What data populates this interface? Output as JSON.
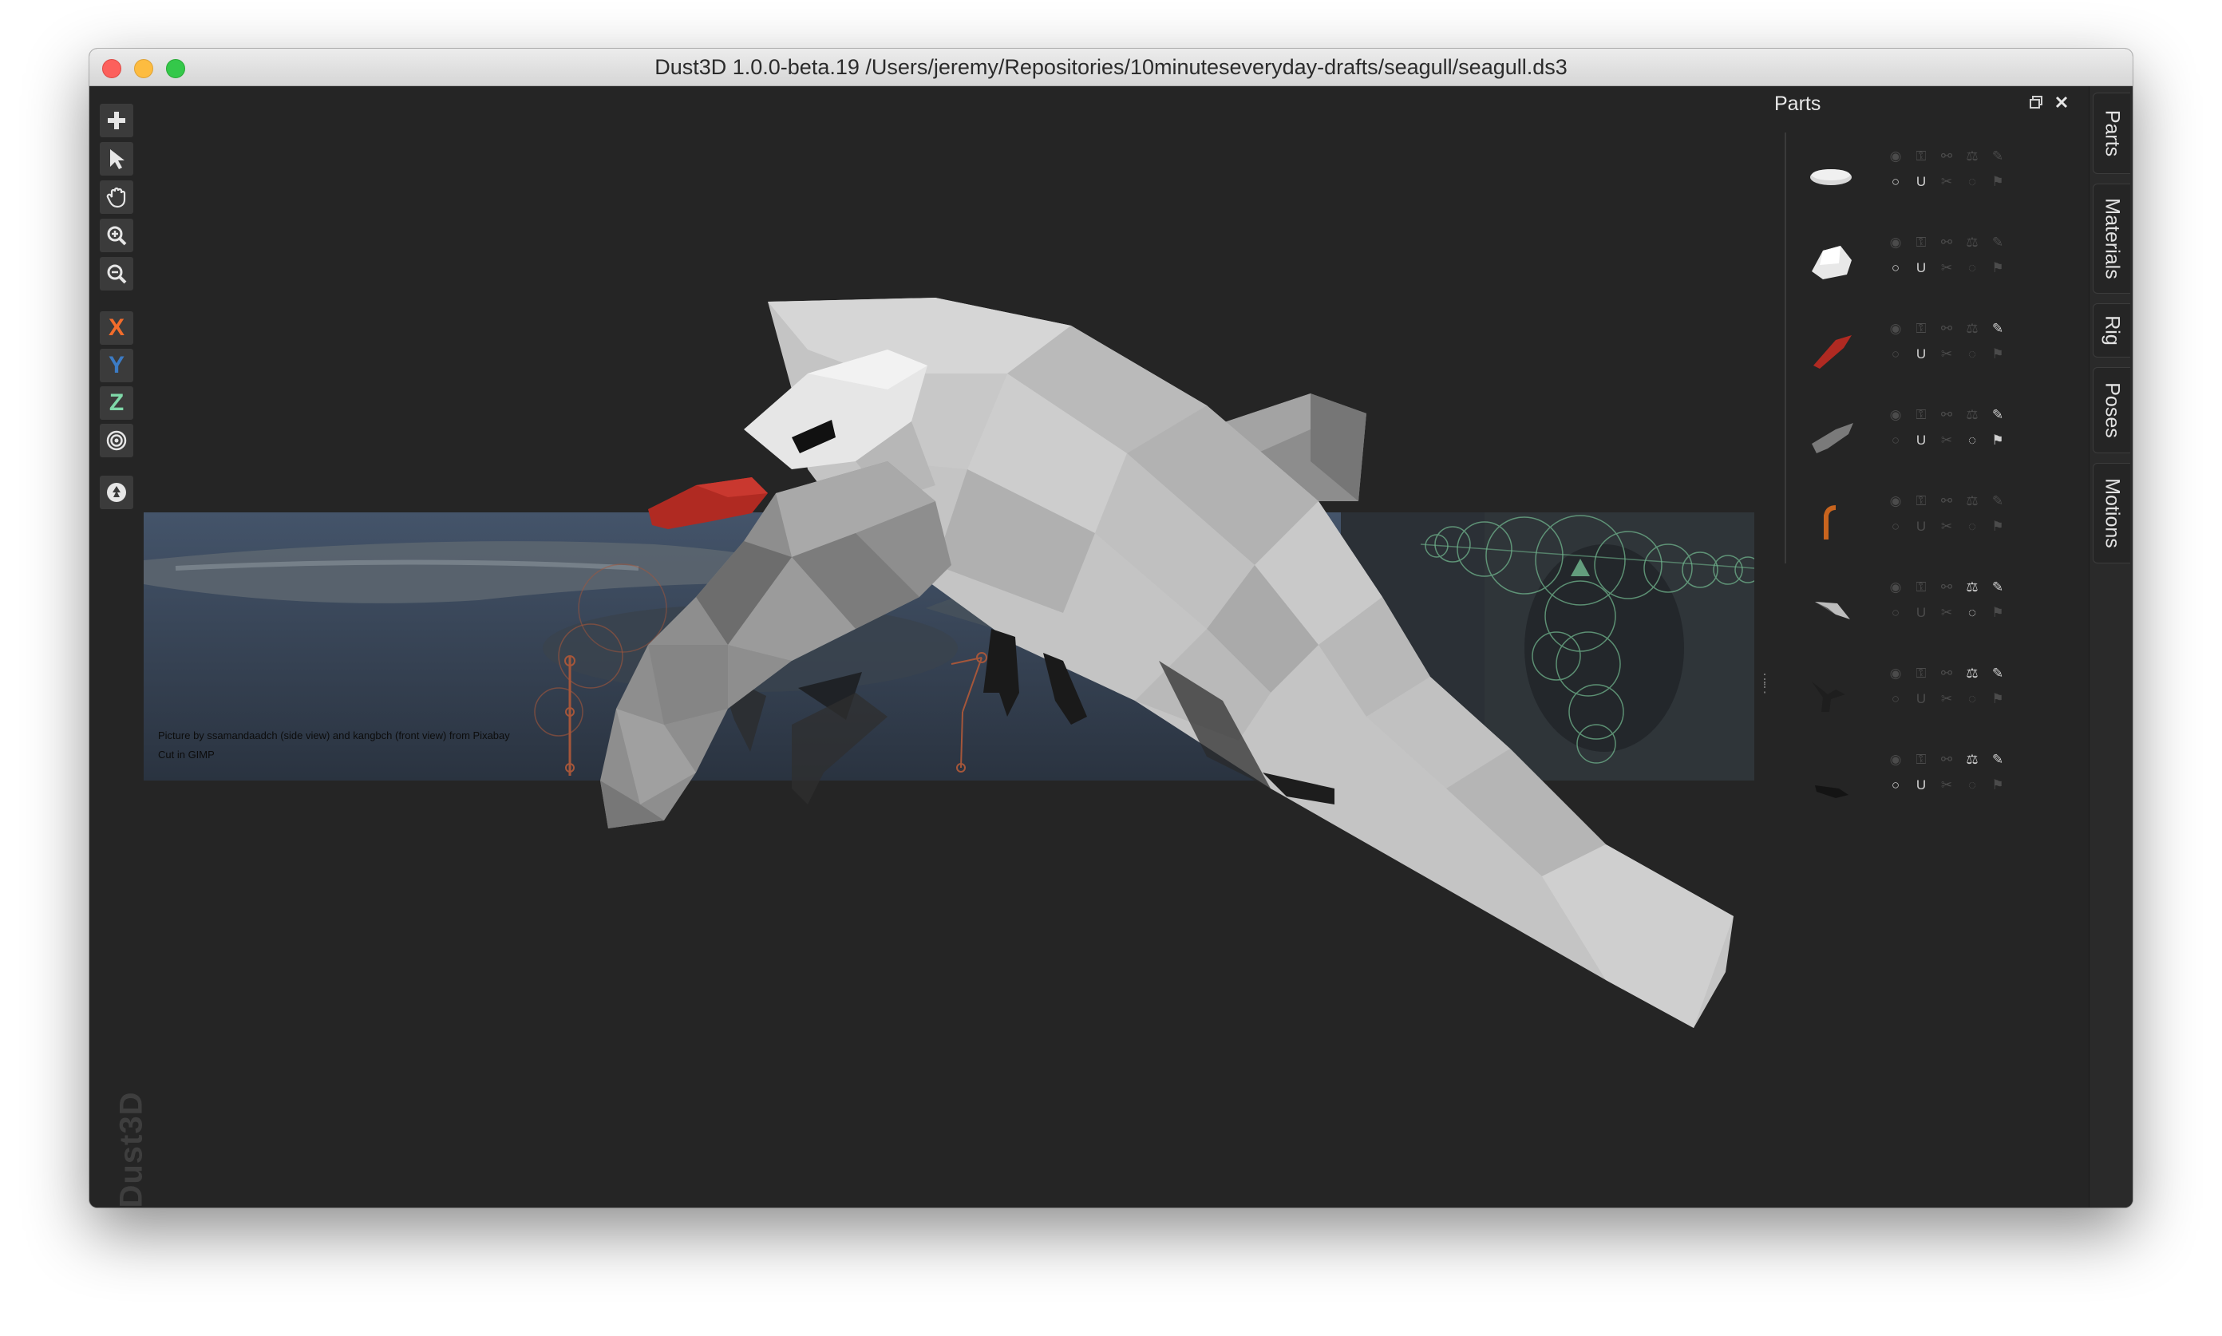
{
  "window": {
    "title": "Dust3D 1.0.0-beta.19 /Users/jeremy/Repositories/10minuteseveryday-drafts/seagull/seagull.ds3"
  },
  "toolbar": {
    "tools": [
      {
        "name": "add-tool",
        "icon": "plus-icon"
      },
      {
        "name": "select-tool",
        "icon": "pointer-icon"
      },
      {
        "name": "drag-tool",
        "icon": "hand-icon"
      },
      {
        "name": "zoom-in-tool",
        "icon": "zoom-in-icon"
      },
      {
        "name": "zoom-out-tool",
        "icon": "zoom-out-icon"
      }
    ],
    "axes": {
      "x": "X",
      "y": "Y",
      "z": "Z"
    },
    "radial_icon": "target-icon",
    "regenerate_icon": "recycle-icon"
  },
  "viewport": {
    "watermark": "Dust3D",
    "reference_caption_line1": "Picture by ssamandaadch (side view) and kangbch (front view) from Pixabay",
    "reference_caption_line2": "Cut in GIMP"
  },
  "parts_panel": {
    "title": "Parts",
    "parts": [
      {
        "thumb": "light-gray-flat-part",
        "color": "#d8d8d8",
        "visible": false,
        "locked": false,
        "subdivided": true,
        "x_mirrored": false
      },
      {
        "thumb": "white-head-part",
        "color": "#e8e8e8",
        "visible": false,
        "locked": false,
        "subdivided": true,
        "x_mirrored": false
      },
      {
        "thumb": "red-beak-part",
        "color": "#b02a22",
        "visible": false,
        "locked": false,
        "subdivided": false,
        "x_mirrored": true
      },
      {
        "thumb": "gray-wing-part",
        "color": "#7a7a7a",
        "visible": false,
        "locked": false,
        "subdivided": false,
        "x_mirrored": true
      },
      {
        "thumb": "orange-leg-part",
        "color": "#c8641e",
        "visible": false,
        "locked": false,
        "subdivided": false,
        "x_mirrored": false
      },
      {
        "thumb": "gray-feather-part",
        "color": "#bdbdbd",
        "visible": false,
        "locked": false,
        "subdivided": false,
        "x_mirrored": true
      },
      {
        "thumb": "black-foot-part",
        "color": "#1e1e1e",
        "visible": false,
        "locked": false,
        "subdivided": false,
        "x_mirrored": true
      },
      {
        "thumb": "black-tip-part",
        "color": "#141414",
        "visible": false,
        "locked": false,
        "subdivided": true,
        "x_mirrored": true
      }
    ]
  },
  "side_tabs": [
    "Parts",
    "Materials",
    "Rig",
    "Poses",
    "Motions"
  ],
  "colors": {
    "viewport_bg": "#252525",
    "axis_x": "#f26c2b",
    "axis_y": "#3c7bc4",
    "axis_z": "#7fd8a8",
    "beak": "#b02a22",
    "body": "#c7c7c7"
  }
}
